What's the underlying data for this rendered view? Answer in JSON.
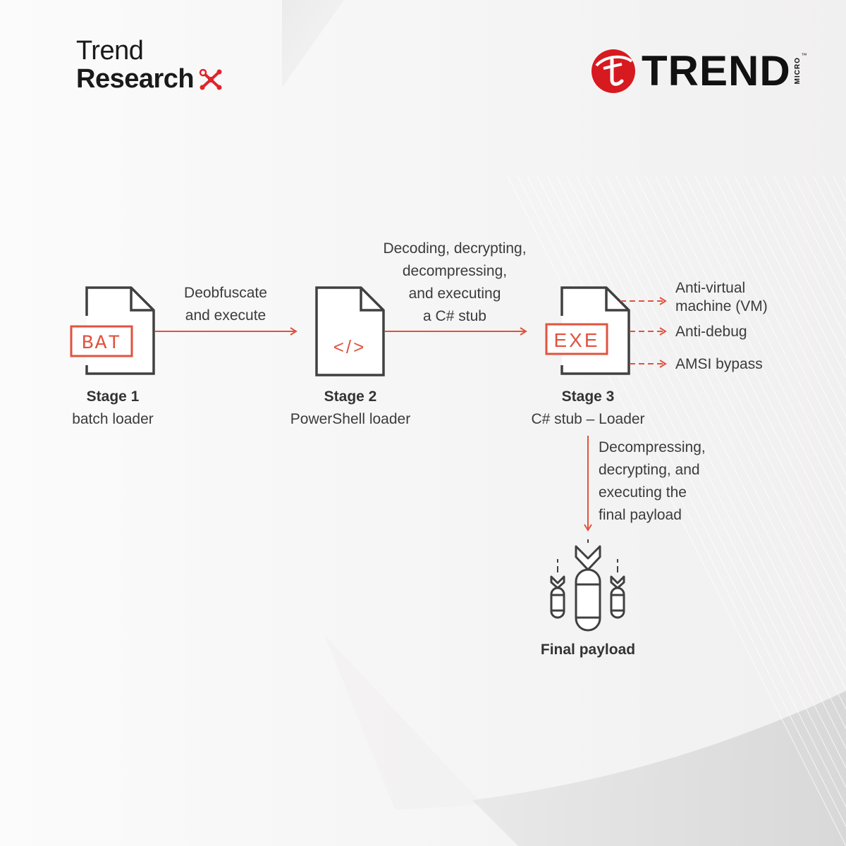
{
  "branding": {
    "research_logo": {
      "line1": "Trend",
      "line2": "Research",
      "icon": "network-node-icon"
    },
    "company_logo": {
      "name": "TREND",
      "sub": "MICRO",
      "trademark": "™",
      "icon": "trend-micro-ball-icon",
      "brand_color": "#d71920"
    }
  },
  "colors": {
    "accent": "#e0533f",
    "icon_stroke": "#404040",
    "text": "#3b3b3b"
  },
  "stages": [
    {
      "title": "Stage 1",
      "subtitle": "batch loader",
      "icon": "bat-file-icon",
      "badge": "BAT"
    },
    {
      "title": "Stage 2",
      "subtitle": "PowerShell loader",
      "icon": "code-file-icon",
      "badge": "</>"
    },
    {
      "title": "Stage 3",
      "subtitle": "C# stub – Loader",
      "icon": "exe-file-icon",
      "badge": "EXE"
    }
  ],
  "transitions": [
    {
      "from": "Stage 1",
      "to": "Stage 2",
      "lines": [
        "Deobfuscate",
        "and execute"
      ]
    },
    {
      "from": "Stage 2",
      "to": "Stage 3",
      "lines": [
        "Decoding, decrypting,",
        "decompressing,",
        "and executing",
        "a C# stub"
      ]
    },
    {
      "from": "Stage 3",
      "to": "Final payload",
      "lines": [
        "Decompressing,",
        "decrypting, and",
        "executing the",
        "final payload"
      ]
    }
  ],
  "evasion_features": [
    {
      "lines": [
        "Anti-virtual",
        "machine (VM)"
      ]
    },
    {
      "lines": [
        "Anti-debug"
      ]
    },
    {
      "lines": [
        "AMSI bypass"
      ]
    }
  ],
  "final": {
    "title": "Final payload",
    "icon": "bombs-icon"
  }
}
